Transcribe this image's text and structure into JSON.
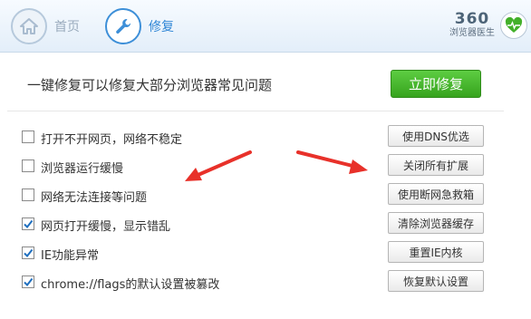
{
  "window": {
    "tabs": [
      {
        "label": "首页",
        "icon": "home-icon",
        "active": false
      },
      {
        "label": "修复",
        "icon": "wrench-icon",
        "active": true
      }
    ],
    "brand": {
      "number": "360",
      "subtitle": "浏览器医生",
      "icon": "heart-pulse-icon"
    }
  },
  "main": {
    "headline": "一键修复可以修复大部分浏览器常见问题",
    "primary_button": "立即修复"
  },
  "issues": [
    {
      "label": "打开不开网页，网络不稳定",
      "checked": false,
      "button": "使用DNS优选"
    },
    {
      "label": "浏览器运行缓慢",
      "checked": false,
      "button": "关闭所有扩展"
    },
    {
      "label": "网络无法连接等问题",
      "checked": false,
      "button": "使用断网急救箱"
    },
    {
      "label": "网页打开缓慢，显示错乱",
      "checked": true,
      "button": "清除浏览器缓存"
    },
    {
      "label": "IE功能异常",
      "checked": true,
      "button": "重置IE内核"
    },
    {
      "label": "chrome://flags的默认设置被篡改",
      "checked": true,
      "button": "恢复默认设置"
    }
  ],
  "colors": {
    "accent_blue": "#2f86d6",
    "primary_green": "#3fb024",
    "annotation_red": "#e8312a",
    "checkbox_check": "#1f6fbf"
  }
}
